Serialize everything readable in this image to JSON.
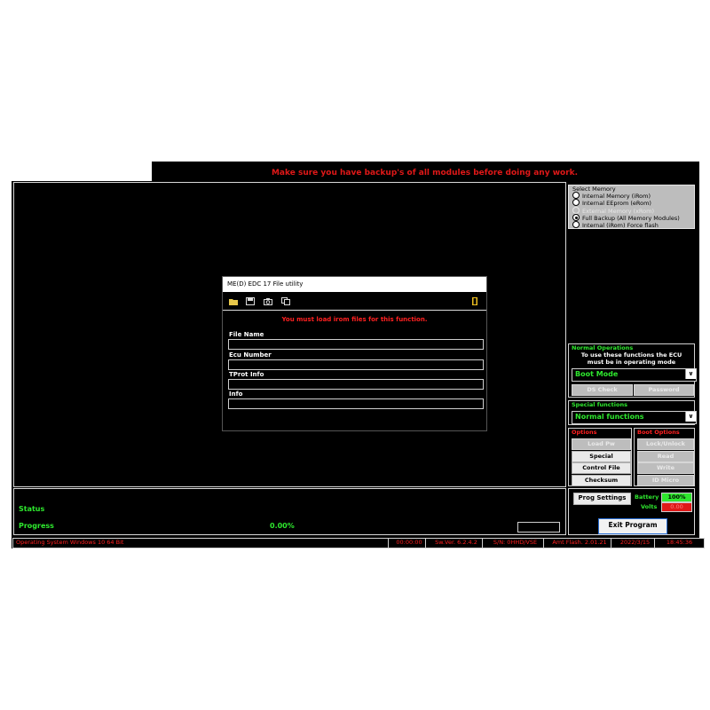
{
  "warning": "Make sure you have backup's of all modules before doing any work.",
  "dialog": {
    "title": "ME(D) EDC 17 File utility",
    "toolbar_icons": [
      "open-folder-icon",
      "save-icon",
      "camera-icon",
      "copy-icon",
      "exit-door-icon"
    ],
    "message": "You must load irom files for this function.",
    "fields": {
      "file_name": {
        "label": "File Name",
        "value": ""
      },
      "ecu_number": {
        "label": "Ecu Number",
        "value": ""
      },
      "tprot_info": {
        "label": "TProt Info",
        "value": ""
      },
      "info": {
        "label": "Info",
        "value": ""
      }
    }
  },
  "select_memory": {
    "title": "Select Memory",
    "options": [
      {
        "label": "Internal Memory (iRom)",
        "selected": false,
        "enabled": true
      },
      {
        "label": "Internal EEprom (eRom)",
        "selected": false,
        "enabled": true
      },
      {
        "label": "External Memory (xRom)",
        "selected": false,
        "enabled": false
      },
      {
        "label": "Full Backup (All Memory Modules)",
        "selected": true,
        "enabled": true
      },
      {
        "label": "Internal (iRom) Force flash",
        "selected": false,
        "enabled": true
      }
    ]
  },
  "normal_operations": {
    "title": "Normal Operations",
    "note_line1": "To use these functions the ECU",
    "note_line2": "must be in operating mode",
    "mode_value": "Boot Mode",
    "ds_check": "DS Check",
    "password": "Password"
  },
  "special_functions": {
    "title": "Special functions",
    "value": "Normal functions"
  },
  "options": {
    "title": "Options",
    "load_pw": "Load Pw",
    "special": "Special",
    "control_file": "Control File",
    "checksum": "Checksum"
  },
  "boot_options": {
    "title": "Boot Options",
    "lock_unlock": "Lock/Unlock",
    "read": "Read",
    "write": "Write",
    "id_micro": "ID Micro"
  },
  "status": {
    "status_label": "Status",
    "progress_label": "Progress",
    "progress_value": "0.00%"
  },
  "settings": {
    "prog_settings": "Prog Settings",
    "battery_label": "Battery",
    "battery_value": "100%",
    "volts_label": "Volts",
    "volts_value": "0.00",
    "exit_program": "Exit Program"
  },
  "statusbar": {
    "os": "Operating System Windows 10 64 Bit",
    "timer": "00:00:00",
    "sw_ver": "Sw.Ver. 6.2.4.2",
    "serial": "S/N: 0HHD/VSE",
    "amt_flash": "Amt Flash. 2.01.21",
    "date": "2022/3/15",
    "time": "18:45:36"
  },
  "colors": {
    "background": "#000000",
    "accent_green": "#2ee82e",
    "alert_red": "#ff2020",
    "disabled_gray": "#bdbdbd"
  }
}
